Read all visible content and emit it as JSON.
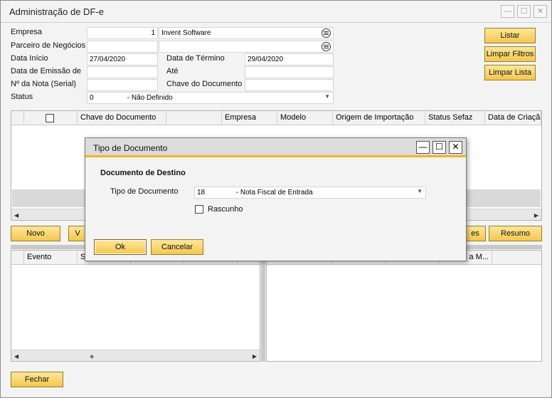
{
  "window": {
    "title": "Administração de DF-e",
    "minimize": "—",
    "maximize": "☐",
    "close": "✕"
  },
  "filters": {
    "empresa": {
      "label": "Empresa",
      "code": "1",
      "name": "Invent Software"
    },
    "parceiro": {
      "label": "Parceiro de Negócios",
      "code": "",
      "name": ""
    },
    "data_inicio": {
      "label": "Data Início",
      "value": "27/04/2020"
    },
    "data_termino": {
      "label": "Data de Término",
      "value": "29/04/2020"
    },
    "data_emissao": {
      "label": "Data de Emissão de",
      "value": ""
    },
    "ate": {
      "label": "Até",
      "value": ""
    },
    "nota": {
      "label": "Nº da Nota (Serial)",
      "value": ""
    },
    "chave": {
      "label": "Chave do Documento",
      "value": ""
    },
    "status": {
      "label": "Status",
      "code": "0",
      "value": "- Não Definido"
    }
  },
  "actions": {
    "listar": "Listar",
    "limpar_filtros": "Limpar Filtros",
    "limpar_lista": "Limpar Lista"
  },
  "main_grid": {
    "columns": [
      "Chave do Documento",
      "Empresa",
      "Modelo",
      "Origem de Importação",
      "Status Sefaz",
      "Data de Criação"
    ]
  },
  "row_buttons": {
    "novo": "Novo",
    "v": "V",
    "es": "es",
    "resumo": "Resumo"
  },
  "events_grid": {
    "columns": [
      "Evento",
      "S"
    ]
  },
  "right_grid": {
    "columns": [
      "",
      "",
      "",
      "a M..."
    ]
  },
  "footer": {
    "fechar": "Fechar"
  },
  "dialog": {
    "title": "Tipo de Documento",
    "section": "Documento de Destino",
    "tipo_label": "Tipo de Documento",
    "tipo_code": "18",
    "tipo_value": "- Nota Fiscal de Entrada",
    "rascunho": "Rascunho",
    "ok": "Ok",
    "cancelar": "Cancelar"
  }
}
